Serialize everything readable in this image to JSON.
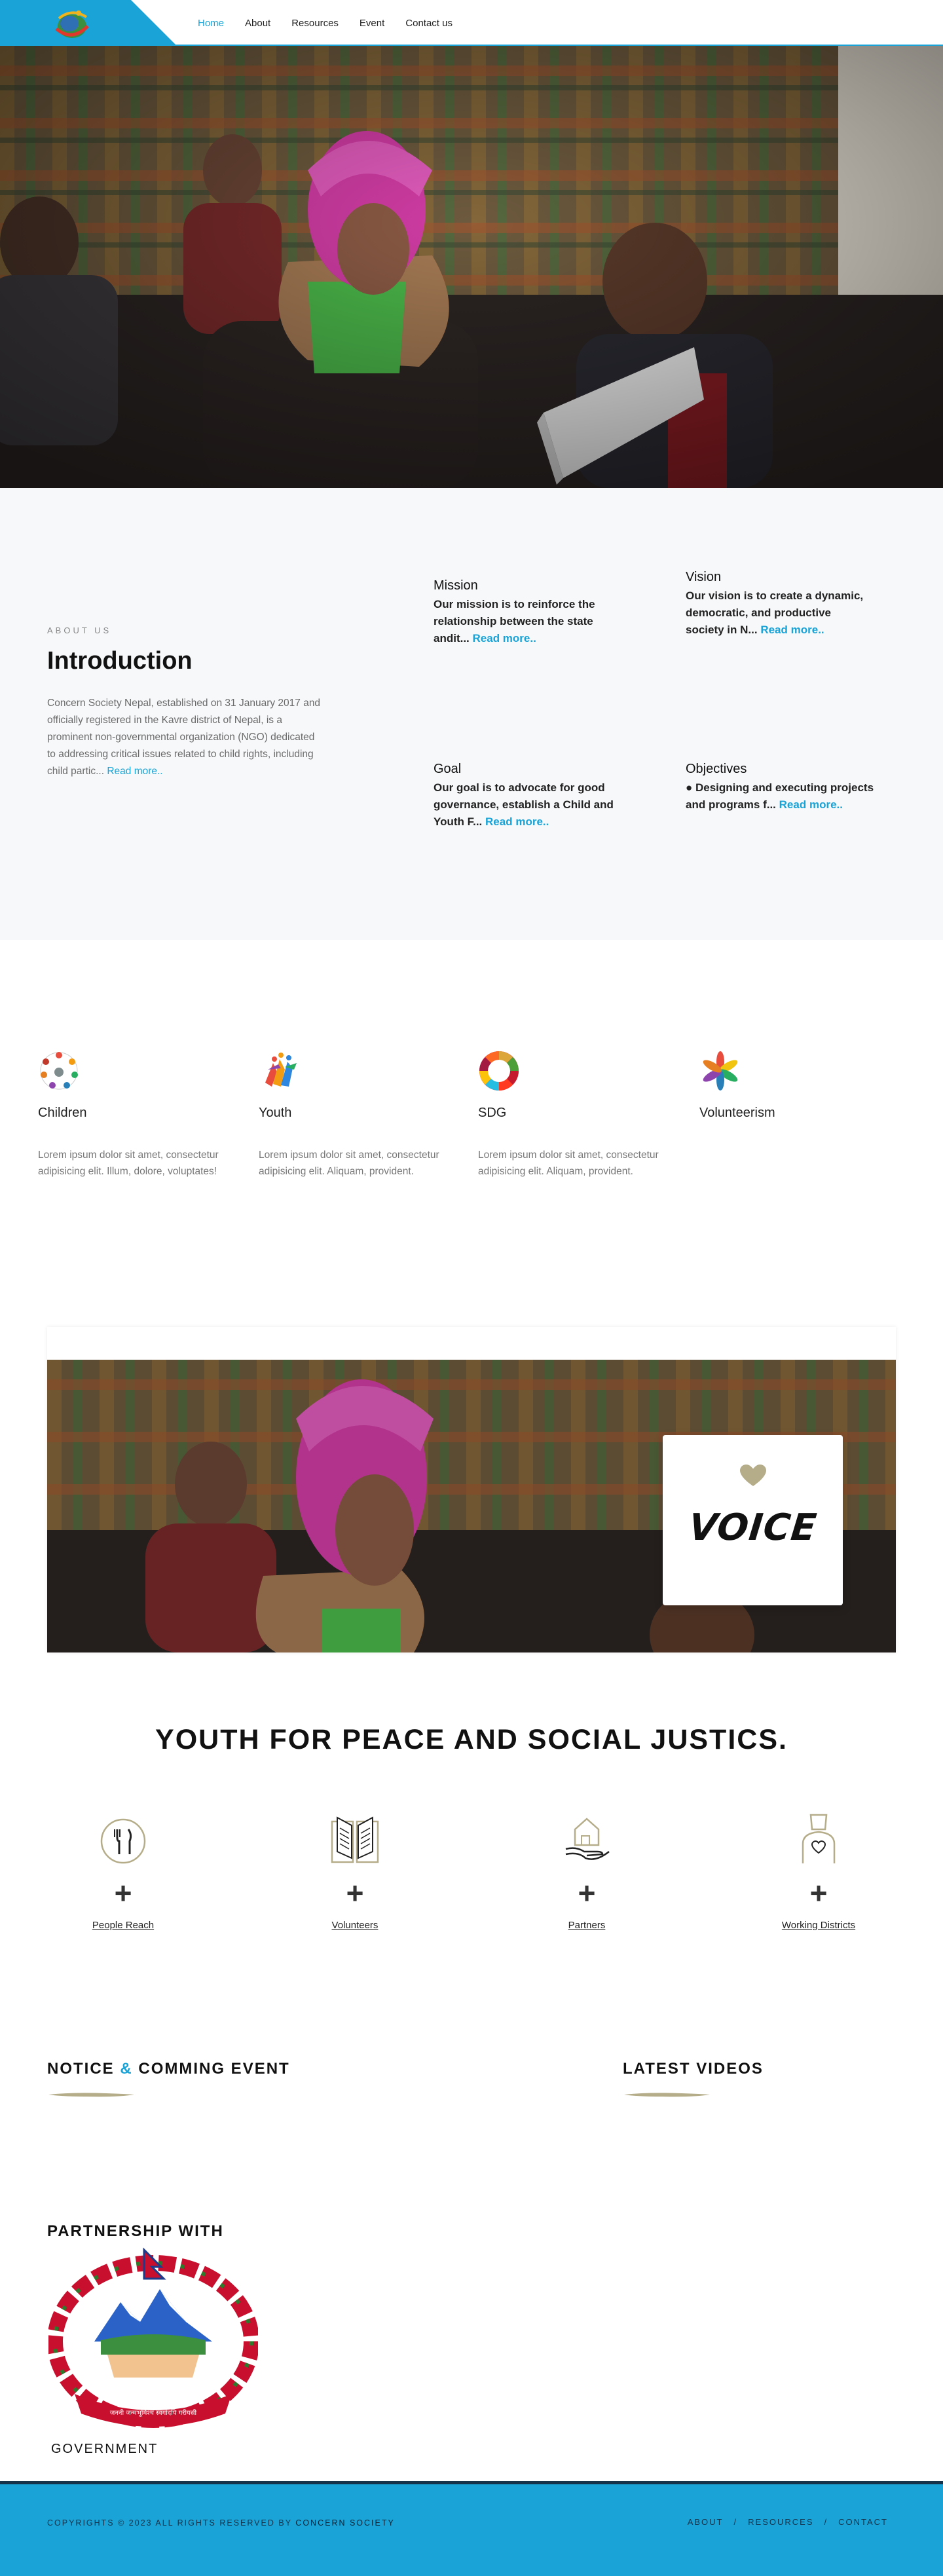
{
  "header": {
    "nav": [
      "Home",
      "About",
      "Resources",
      "Event",
      "Contact us"
    ],
    "active_index": 0,
    "accent": "#1aa3d6"
  },
  "hero": {
    "image": "hero-photo-girl-pink-hat",
    "mail_icon": "envelope-icon"
  },
  "intro": {
    "eyebrow": "ABOUT US",
    "title": "Introduction",
    "text": "Concern Society Nepal, established on 31 January 2017 and officially registered in the Kavre district of Nepal, is a prominent non-governmental organization (NGO) dedicated to addressing critical issues related to child rights, including child partic...",
    "more": "Read more..",
    "cards": [
      {
        "title": "Mission",
        "body": "Our mission is to reinforce the relationship between the state andit...",
        "more": "Read more.."
      },
      {
        "title": "Vision",
        "body": "Our vision is to create a dynamic, democratic, and productive society in N...",
        "more": "Read more.."
      },
      {
        "title": "Goal",
        "body": "Our goal is to advocate for good governance, establish a Child and Youth F...",
        "more": "Read more.."
      },
      {
        "title": "Objectives",
        "body": "● Designing and executing projects and programs f...",
        "more": "Read more.."
      }
    ]
  },
  "services": [
    {
      "title": "Children",
      "text": "Lorem ipsum dolor sit amet, consectetur adipisicing elit. Illum, dolore, voluptates!",
      "icon": "children-circle-icon"
    },
    {
      "title": "Youth",
      "text": "Lorem ipsum dolor sit amet, consectetur adipisicing elit. Aliquam, provident.",
      "icon": "youth-people-icon"
    },
    {
      "title": "SDG",
      "text": "Lorem ipsum dolor sit amet, consectetur adipisicing elit. Aliquam, provident.",
      "icon": "sdg-wheel-icon"
    },
    {
      "title": "Volunteerism",
      "text": "",
      "icon": "volunteer-hands-icon"
    }
  ],
  "voice": {
    "word": "VOICE",
    "heart_color": "#b5ad8a"
  },
  "youth": {
    "title": "YOUTH FOR PEACE AND SOCIAL JUSTICS.",
    "stats": [
      {
        "label": "People Reach",
        "plus": "+",
        "icon": "utensils-icon"
      },
      {
        "label": "Volunteers",
        "plus": "+",
        "icon": "book-icon"
      },
      {
        "label": "Partners",
        "plus": "+",
        "icon": "hand-house-icon"
      },
      {
        "label": "Working Districts",
        "plus": "+",
        "icon": "person-heart-icon"
      }
    ]
  },
  "notice": {
    "title_a": "NOTICE",
    "amp": "&",
    "title_b": "COMMING EVENT"
  },
  "videos": {
    "title": "LATEST VIDEOS"
  },
  "partnership": {
    "title": "PARTNERSHIP WITH",
    "partner": "GOVERNMENT",
    "emblem": "nepal-emblem-icon"
  },
  "footer": {
    "copyright_prefix": "COPYRIGHTS © 2023 ALL RIGHTS RESERVED BY",
    "copyright_org": "CONCERN SOCIETY",
    "links": [
      "ABOUT",
      "RESOURCES",
      "CONTACT"
    ],
    "separator": "/"
  }
}
